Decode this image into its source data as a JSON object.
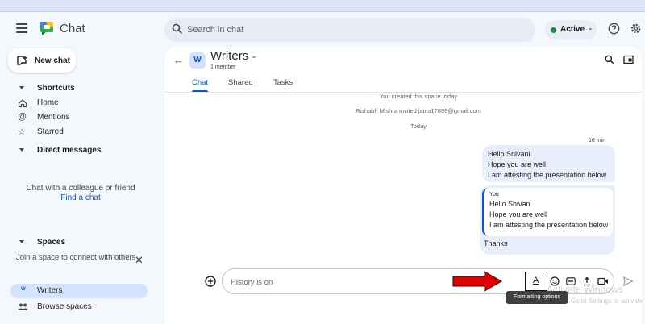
{
  "app": {
    "name": "Chat"
  },
  "search": {
    "placeholder": "Search in chat"
  },
  "status": {
    "label": "Active",
    "color": "#1e8e3e"
  },
  "sidebar": {
    "new_chat_label": "New chat",
    "shortcuts_label": "Shortcuts",
    "shortcuts": [
      {
        "label": "Home",
        "icon": "home-icon"
      },
      {
        "label": "Mentions",
        "icon": "at-icon"
      },
      {
        "label": "Starred",
        "icon": "star-icon"
      }
    ],
    "direct_messages_label": "Direct messages",
    "dm_empty_text": "Chat with a colleague or friend",
    "find_chat_label": "Find a chat",
    "spaces_label": "Spaces",
    "join_text": "Join a space to connect with others",
    "spaces": [
      {
        "avatar": "W",
        "label": "Writers"
      }
    ],
    "browse_label": "Browse spaces"
  },
  "space": {
    "avatar": "W",
    "title": "Writers",
    "members": "1 member",
    "tabs": [
      "Chat",
      "Shared",
      "Tasks"
    ],
    "active_tab": "Chat"
  },
  "messages": {
    "system": [
      "You created this space today",
      "Rishabh Mishra invited jains17899@gmail.com"
    ],
    "day_label": "Today",
    "timestamp": "16 min",
    "bubble1": [
      "Hello Shivani",
      "Hope you are well",
      "I am attesting the presentation below"
    ],
    "quote_author": "You",
    "quote": [
      "Hello Shivani",
      "Hope you are well",
      "I am attesting the presentation below"
    ],
    "reply": "Thanks"
  },
  "composer": {
    "placeholder": "History is on",
    "format_glyph": "A",
    "tooltip": "Formatting options"
  },
  "overlay": {
    "watermark_title": "Activate Windows",
    "watermark_sub": "Go to Settings to activate Windows."
  },
  "colors": {
    "accent": "#0b57d0",
    "arrow": "#e00000"
  }
}
